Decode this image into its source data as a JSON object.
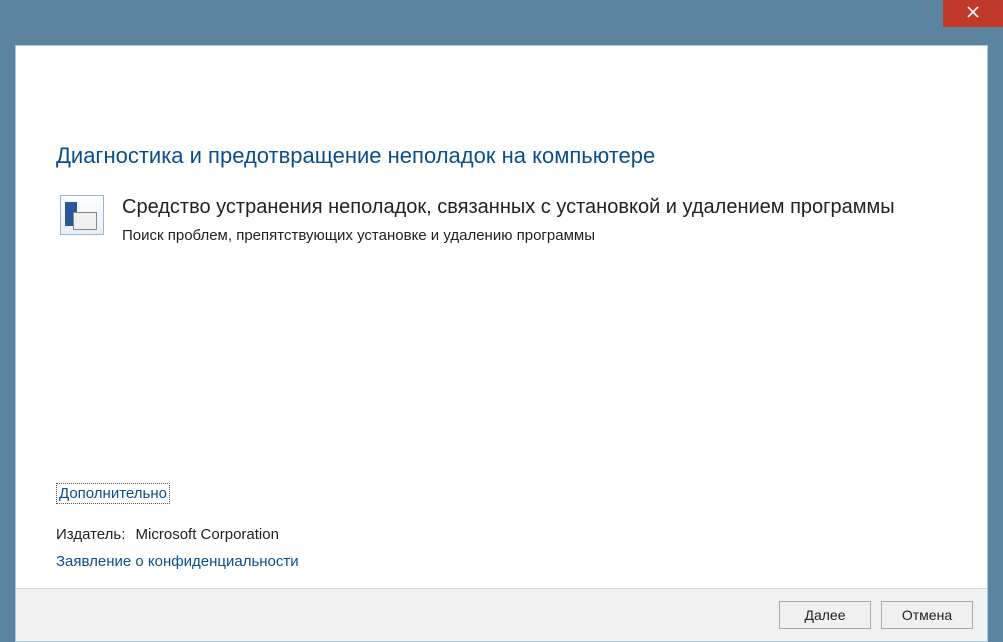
{
  "colors": {
    "frame": "#5d849f",
    "heading": "#0a4e8c",
    "close": "#c0392b"
  },
  "icons": {
    "close": "close-icon",
    "back": "back-arrow-icon",
    "title": "troubleshooter-icon",
    "item": "monitor-tool-icon"
  },
  "header": {
    "title": "Средство устранения неполадок, связанных с установкой и удалением программы"
  },
  "content": {
    "heading": "Диагностика и предотвращение неполадок на компьютере",
    "item": {
      "title": "Средство устранения неполадок, связанных с установкой и удалением программы",
      "description": "Поиск проблем, препятствующих установке и удалению программы"
    },
    "advanced_link": "Дополнительно",
    "publisher_label": "Издатель:",
    "publisher_value": "Microsoft Corporation",
    "privacy_link": "Заявление о конфиденциальности"
  },
  "footer": {
    "next_mnemonic": "Д",
    "next_rest": "алее",
    "cancel": "Отмена"
  }
}
